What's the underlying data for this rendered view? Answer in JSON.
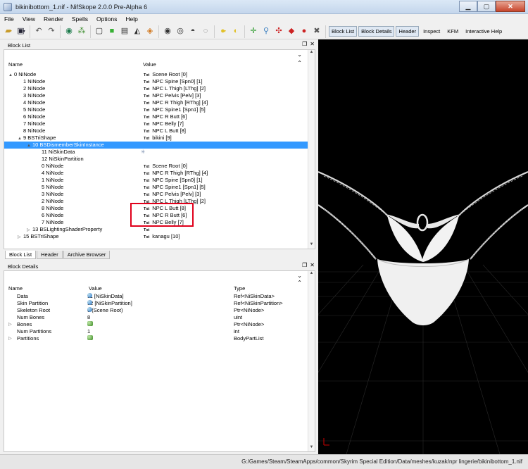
{
  "window": {
    "title": "bikinibottom_1.nif - NifSkope 2.0.0 Pre-Alpha 6"
  },
  "menu": [
    "File",
    "View",
    "Render",
    "Spells",
    "Options",
    "Help"
  ],
  "toolbar": {
    "text_buttons": [
      "Block List",
      "Block Details",
      "Header",
      "Inspect",
      "KFM",
      "Interactive Help"
    ]
  },
  "block_list": {
    "panel_title": "Block List",
    "col_name": "Name",
    "col_value": "Value",
    "rows": [
      {
        "indent": 0,
        "exp": "▲",
        "name": "0 NiNode",
        "tag": "Txt",
        "value": "Scene Root [0]"
      },
      {
        "indent": 1,
        "exp": "",
        "name": "1 NiNode",
        "tag": "Txt",
        "value": "NPC Spine [Spn0] [1]"
      },
      {
        "indent": 1,
        "exp": "",
        "name": "2 NiNode",
        "tag": "Txt",
        "value": "NPC L Thigh [LThg] [2]"
      },
      {
        "indent": 1,
        "exp": "",
        "name": "3 NiNode",
        "tag": "Txt",
        "value": "NPC Pelvis [Pelv] [3]"
      },
      {
        "indent": 1,
        "exp": "",
        "name": "4 NiNode",
        "tag": "Txt",
        "value": "NPC R Thigh [RThg] [4]"
      },
      {
        "indent": 1,
        "exp": "",
        "name": "5 NiNode",
        "tag": "Txt",
        "value": "NPC Spine1 [Spn1] [5]"
      },
      {
        "indent": 1,
        "exp": "",
        "name": "6 NiNode",
        "tag": "Txt",
        "value": "NPC R Butt [6]"
      },
      {
        "indent": 1,
        "exp": "",
        "name": "7 NiNode",
        "tag": "Txt",
        "value": "NPC Belly [7]"
      },
      {
        "indent": 1,
        "exp": "",
        "name": "8 NiNode",
        "tag": "Txt",
        "value": "NPC L Butt [8]"
      },
      {
        "indent": 1,
        "exp": "▲",
        "name": "9 BSTriShape",
        "tag": "Txt",
        "value": "bikini [9]"
      },
      {
        "indent": 2,
        "exp": "▲",
        "name": "10 BSDismemberSkinInstance",
        "tag": "",
        "value": "",
        "selected": true
      },
      {
        "indent": 3,
        "exp": "",
        "name": "11 NiSkinData",
        "tag": "",
        "value": "✳"
      },
      {
        "indent": 3,
        "exp": "",
        "name": "12 NiSkinPartition",
        "tag": "",
        "value": ""
      },
      {
        "indent": 3,
        "exp": "",
        "name": "0 NiNode",
        "tag": "Txt",
        "value": "Scene Root [0]"
      },
      {
        "indent": 3,
        "exp": "",
        "name": "4 NiNode",
        "tag": "Txt",
        "value": "NPC R Thigh [RThg] [4]"
      },
      {
        "indent": 3,
        "exp": "",
        "name": "1 NiNode",
        "tag": "Txt",
        "value": "NPC Spine [Spn0] [1]"
      },
      {
        "indent": 3,
        "exp": "",
        "name": "5 NiNode",
        "tag": "Txt",
        "value": "NPC Spine1 [Spn1] [5]"
      },
      {
        "indent": 3,
        "exp": "",
        "name": "3 NiNode",
        "tag": "Txt",
        "value": "NPC Pelvis [Pelv] [3]"
      },
      {
        "indent": 3,
        "exp": "",
        "name": "2 NiNode",
        "tag": "Txt",
        "value": "NPC L Thigh [LThg] [2]"
      },
      {
        "indent": 3,
        "exp": "",
        "name": "8 NiNode",
        "tag": "Txt",
        "value": "NPC L Butt [8]"
      },
      {
        "indent": 3,
        "exp": "",
        "name": "6 NiNode",
        "tag": "Txt",
        "value": "NPC R Butt [6]"
      },
      {
        "indent": 3,
        "exp": "",
        "name": "7 NiNode",
        "tag": "Txt",
        "value": "NPC Belly [7]"
      },
      {
        "indent": 2,
        "exp": "▷",
        "name": "13 BSLightingShaderProperty",
        "tag": "Txt",
        "value": ""
      },
      {
        "indent": 1,
        "exp": "▷",
        "name": "15 BSTriShape",
        "tag": "Txt",
        "value": "kanagu [10]"
      }
    ]
  },
  "tabs": [
    "Block List",
    "Header",
    "Archive Browser"
  ],
  "block_details": {
    "panel_title": "Block Details",
    "col_name": "Name",
    "col_value": "Value",
    "col_type": "Type",
    "rows": [
      {
        "exp": "",
        "name": "Data",
        "icon": "ref",
        "value": "11 [NiSkinData]",
        "type": "Ref<NiSkinData>"
      },
      {
        "exp": "",
        "name": "Skin Partition",
        "icon": "ref",
        "value": "12 [NiSkinPartition]",
        "type": "Ref<NiSkinPartition>"
      },
      {
        "exp": "",
        "name": "Skeleton Root",
        "icon": "ref",
        "value": "0 (Scene Root)",
        "type": "Ptr<NiNode>"
      },
      {
        "exp": "",
        "name": "Num Bones",
        "icon": "",
        "value": "8",
        "type": "uint"
      },
      {
        "exp": "▷",
        "name": "Bones",
        "icon": "grp",
        "value": "",
        "type": "Ptr<NiNode>"
      },
      {
        "exp": "",
        "name": "Num Partitions",
        "icon": "",
        "value": "1",
        "type": "int"
      },
      {
        "exp": "▷",
        "name": "Partitions",
        "icon": "grp",
        "value": "",
        "type": "BodyPartList"
      }
    ]
  },
  "status": {
    "path": "G:/Games/Steam/SteamApps/common/Skyrim Special Edition/Data/meshes/kuzak/npr lingerie/bikinibottom_1.nif"
  },
  "colors": {
    "selection": "#3399ff",
    "highlight_box": "#e0001b",
    "viewport_bg": "#000000"
  }
}
